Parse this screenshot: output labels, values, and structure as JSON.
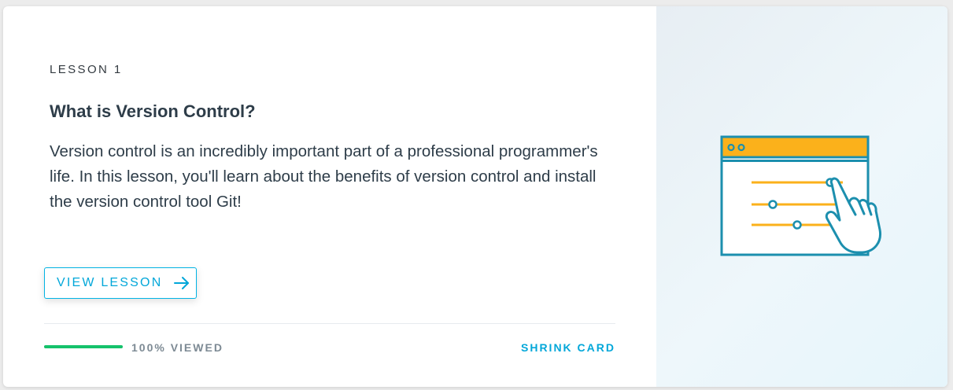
{
  "card": {
    "eyebrow": "LESSON 1",
    "title": "What is Version Control?",
    "description": "Version control is an incredibly important part of a professional programmer's life. In this lesson, you'll learn about the benefits of version control and install the version control tool Git!",
    "view_button_label": "VIEW LESSON",
    "view_button_icon": "arrow-right-icon",
    "progress_text": "100% VIEWED",
    "progress_fraction": 1.0,
    "shrink_label": "SHRINK CARD",
    "illustration_icon": "browser-sliders-hand-icon"
  },
  "colors": {
    "accent": "#02b3e4",
    "progress": "#15c26b",
    "illustration_primary": "#1c8fae",
    "illustration_secondary": "#fbb11b"
  }
}
